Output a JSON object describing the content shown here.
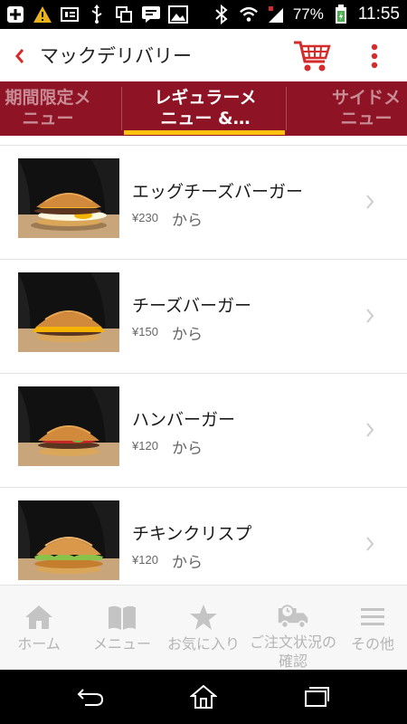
{
  "status_bar": {
    "battery_percent": "77%",
    "time": "11:55",
    "icons": [
      "plus-icon",
      "warning-icon",
      "sim-icon",
      "usb-icon",
      "screen-icon",
      "message-icon",
      "image-icon",
      "bluetooth-icon",
      "wifi-icon",
      "signal-icon",
      "battery-icon"
    ]
  },
  "app_bar": {
    "title": "マックデリバリー",
    "icons": [
      "back-icon",
      "cart-icon",
      "more-icon"
    ],
    "accent_color": "#d62b2b"
  },
  "tabs": {
    "items": [
      {
        "line1": "期間限定メ",
        "line2": "ニュー",
        "selected": false
      },
      {
        "line1": "レギュラーメ",
        "line2": "ニュー &…",
        "selected": true
      },
      {
        "line1": "サイドメ",
        "line2": "ニュー",
        "selected": false
      }
    ],
    "background_color": "#8e1425",
    "indicator_color": "#ffc20e"
  },
  "menu": {
    "items": [
      {
        "name": "エッグチーズバーガー",
        "price": "¥230",
        "from": "から",
        "thumb": "egg-cheese-burger-image"
      },
      {
        "name": "チーズバーガー",
        "price": "¥150",
        "from": "から",
        "thumb": "cheeseburger-image"
      },
      {
        "name": "ハンバーガー",
        "price": "¥120",
        "from": "から",
        "thumb": "hamburger-image"
      },
      {
        "name": "チキンクリスプ",
        "price": "¥120",
        "from": "から",
        "thumb": "chicken-crisp-image"
      }
    ]
  },
  "bottom_nav": {
    "items": [
      {
        "label": "ホーム",
        "icon": "home-icon"
      },
      {
        "label": "メニュー",
        "icon": "menu-book-icon"
      },
      {
        "label": "お気に入り",
        "icon": "star-icon"
      },
      {
        "label": "ご注文状況の",
        "label2": "確認",
        "icon": "delivery-truck-icon"
      },
      {
        "label": "その他",
        "icon": "hamburger-menu-icon"
      }
    ]
  },
  "system_nav": {
    "icons": [
      "system-back-icon",
      "system-home-icon",
      "system-recents-icon"
    ]
  }
}
